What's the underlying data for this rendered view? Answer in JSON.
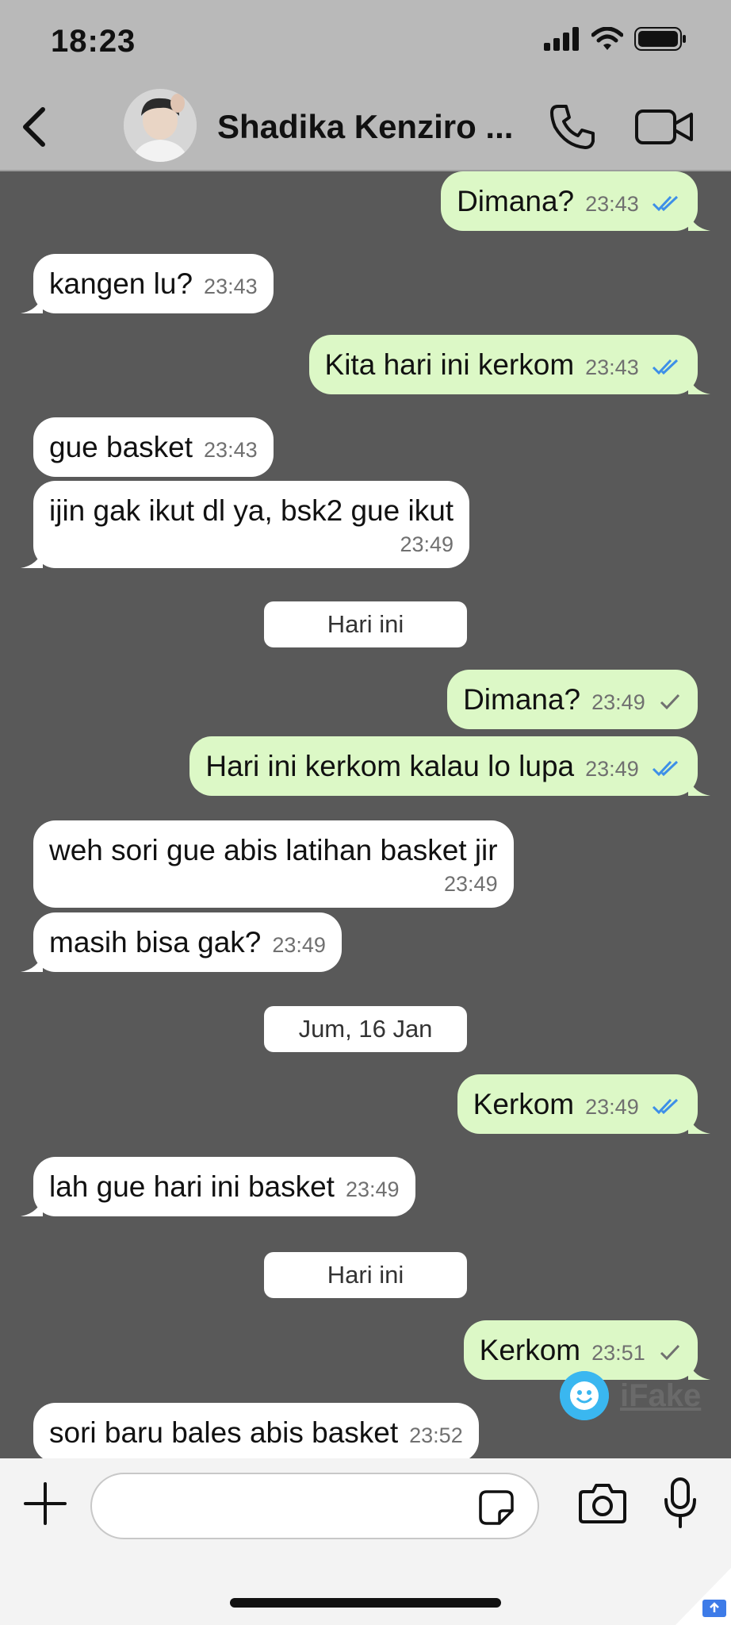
{
  "status": {
    "time": "18:23"
  },
  "header": {
    "contact_name": "Shadika Kenziro ...",
    "avatar": "contact-avatar-photo"
  },
  "messages": [
    {
      "dir": "out",
      "text": "Dimana?",
      "time": "23:43",
      "ticks": "double-blue"
    },
    {
      "dir": "in",
      "text": "kangen lu?",
      "time": "23:43"
    },
    {
      "dir": "out",
      "text": "Kita hari ini kerkom",
      "time": "23:43",
      "ticks": "double-blue"
    },
    {
      "dir": "in",
      "text": "gue basket",
      "time": "23:43"
    },
    {
      "dir": "in",
      "text": "ijin gak ikut dl ya, bsk2 gue ikut",
      "time": "23:49"
    },
    {
      "dir": "out",
      "text": "Dimana?",
      "time": "23:49",
      "ticks": "single-grey"
    },
    {
      "dir": "out",
      "text": "Hari ini kerkom kalau lo lupa",
      "time": "23:49",
      "ticks": "double-blue"
    },
    {
      "dir": "in",
      "text": "weh sori gue abis latihan basket jir",
      "time": "23:49"
    },
    {
      "dir": "in",
      "text": "masih bisa gak?",
      "time": "23:49"
    },
    {
      "dir": "out",
      "text": "Kerkom",
      "time": "23:49",
      "ticks": "double-blue"
    },
    {
      "dir": "in",
      "text": "lah gue hari ini basket",
      "time": "23:49"
    },
    {
      "dir": "out",
      "text": "Kerkom",
      "time": "23:51",
      "ticks": "single-grey"
    },
    {
      "dir": "in",
      "text": "sori baru bales abis basket",
      "time": "23:52"
    }
  ],
  "date_chips": [
    "Hari ini",
    "Jum, 16 Jan",
    "Hari ini"
  ],
  "watermark": {
    "text": "iFake"
  },
  "colors": {
    "out_bubble": "#dcf8c6",
    "in_bubble": "#ffffff",
    "read_tick": "#3d8fe8",
    "chat_bg": "#595959",
    "header_bg": "#b9b9b9"
  }
}
